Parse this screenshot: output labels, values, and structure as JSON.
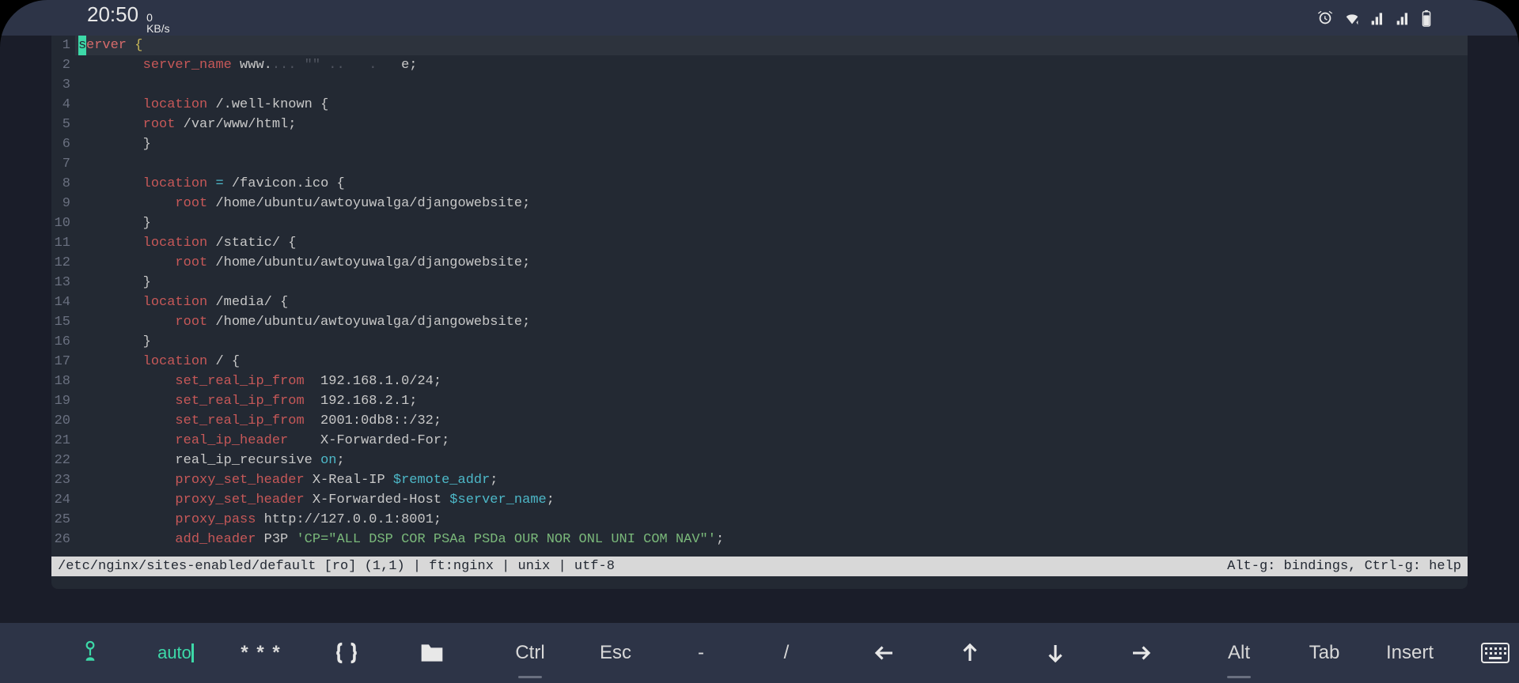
{
  "statusbar": {
    "time": "20:50",
    "net_value": "0",
    "net_unit": "KB/s"
  },
  "code": {
    "lines": [
      {
        "n": 1,
        "indent": 0,
        "tokens": [
          {
            "t": "s",
            "cls": "cursor-block"
          },
          {
            "t": "erver",
            "cls": "kw-server"
          },
          {
            "t": " ",
            "cls": "plain"
          },
          {
            "t": "{",
            "cls": "kw-yellow"
          }
        ],
        "hl": true
      },
      {
        "n": 2,
        "indent": 8,
        "tokens": [
          {
            "t": "server_name",
            "cls": "kw-red"
          },
          {
            "t": " www.",
            "cls": "plain"
          },
          {
            "t": "... \"\" ..   .  ",
            "cls": "faded"
          },
          {
            "t": " e;",
            "cls": "plain"
          }
        ]
      },
      {
        "n": 3,
        "indent": 0,
        "tokens": []
      },
      {
        "n": 4,
        "indent": 8,
        "tokens": [
          {
            "t": "location",
            "cls": "kw-red"
          },
          {
            "t": " /.well-known {",
            "cls": "plain"
          }
        ]
      },
      {
        "n": 5,
        "indent": 8,
        "tokens": [
          {
            "t": "root",
            "cls": "kw-red"
          },
          {
            "t": " /var/www/html;",
            "cls": "plain"
          }
        ]
      },
      {
        "n": 6,
        "indent": 8,
        "tokens": [
          {
            "t": "}",
            "cls": "plain"
          }
        ]
      },
      {
        "n": 7,
        "indent": 0,
        "tokens": []
      },
      {
        "n": 8,
        "indent": 8,
        "tokens": [
          {
            "t": "location",
            "cls": "kw-red"
          },
          {
            "t": " ",
            "cls": "plain"
          },
          {
            "t": "=",
            "cls": "kw-cyan"
          },
          {
            "t": " /favicon.ico {",
            "cls": "plain"
          }
        ]
      },
      {
        "n": 9,
        "indent": 12,
        "tokens": [
          {
            "t": "root",
            "cls": "kw-red"
          },
          {
            "t": " /home/ubuntu/awtoyuwalga/djangowebsite;",
            "cls": "plain"
          }
        ]
      },
      {
        "n": 10,
        "indent": 8,
        "tokens": [
          {
            "t": "}",
            "cls": "plain"
          }
        ]
      },
      {
        "n": 11,
        "indent": 8,
        "tokens": [
          {
            "t": "location",
            "cls": "kw-red"
          },
          {
            "t": " /static/ {",
            "cls": "plain"
          }
        ]
      },
      {
        "n": 12,
        "indent": 12,
        "tokens": [
          {
            "t": "root",
            "cls": "kw-red"
          },
          {
            "t": " /home/ubuntu/awtoyuwalga/djangowebsite;",
            "cls": "plain"
          }
        ]
      },
      {
        "n": 13,
        "indent": 8,
        "tokens": [
          {
            "t": "}",
            "cls": "plain"
          }
        ]
      },
      {
        "n": 14,
        "indent": 8,
        "tokens": [
          {
            "t": "location",
            "cls": "kw-red"
          },
          {
            "t": " /media/ {",
            "cls": "plain"
          }
        ]
      },
      {
        "n": 15,
        "indent": 12,
        "tokens": [
          {
            "t": "root",
            "cls": "kw-red"
          },
          {
            "t": " /home/ubuntu/awtoyuwalga/djangowebsite;",
            "cls": "plain"
          }
        ]
      },
      {
        "n": 16,
        "indent": 8,
        "tokens": [
          {
            "t": "}",
            "cls": "plain"
          }
        ]
      },
      {
        "n": 17,
        "indent": 8,
        "tokens": [
          {
            "t": "location",
            "cls": "kw-red"
          },
          {
            "t": " / {",
            "cls": "plain"
          }
        ]
      },
      {
        "n": 18,
        "indent": 12,
        "tokens": [
          {
            "t": "set_real_ip_from",
            "cls": "kw-red"
          },
          {
            "t": "  192.168.1.0/24;",
            "cls": "plain"
          }
        ]
      },
      {
        "n": 19,
        "indent": 12,
        "tokens": [
          {
            "t": "set_real_ip_from",
            "cls": "kw-red"
          },
          {
            "t": "  192.168.2.1;",
            "cls": "plain"
          }
        ]
      },
      {
        "n": 20,
        "indent": 12,
        "tokens": [
          {
            "t": "set_real_ip_from",
            "cls": "kw-red"
          },
          {
            "t": "  2001:0db8::/32;",
            "cls": "plain"
          }
        ]
      },
      {
        "n": 21,
        "indent": 12,
        "tokens": [
          {
            "t": "real_ip_header",
            "cls": "kw-red"
          },
          {
            "t": "    X-Forwarded-For;",
            "cls": "plain"
          }
        ]
      },
      {
        "n": 22,
        "indent": 12,
        "tokens": [
          {
            "t": "real_ip_recursive ",
            "cls": "plain"
          },
          {
            "t": "on",
            "cls": "kw-cyan"
          },
          {
            "t": ";",
            "cls": "plain"
          }
        ]
      },
      {
        "n": 23,
        "indent": 12,
        "tokens": [
          {
            "t": "proxy_set_header",
            "cls": "kw-red"
          },
          {
            "t": " X-Real-IP ",
            "cls": "plain"
          },
          {
            "t": "$remote_addr",
            "cls": "kw-cyan"
          },
          {
            "t": ";",
            "cls": "plain"
          }
        ]
      },
      {
        "n": 24,
        "indent": 12,
        "tokens": [
          {
            "t": "proxy_set_header",
            "cls": "kw-red"
          },
          {
            "t": " X-Forwarded-Host ",
            "cls": "plain"
          },
          {
            "t": "$server_name",
            "cls": "kw-cyan"
          },
          {
            "t": ";",
            "cls": "plain"
          }
        ]
      },
      {
        "n": 25,
        "indent": 12,
        "tokens": [
          {
            "t": "proxy_pass",
            "cls": "kw-red"
          },
          {
            "t": " http://127.0.0.1:8001;",
            "cls": "plain"
          }
        ]
      },
      {
        "n": 26,
        "indent": 12,
        "tokens": [
          {
            "t": "add_header",
            "cls": "kw-red"
          },
          {
            "t": " P3P ",
            "cls": "plain"
          },
          {
            "t": "'CP=\"ALL DSP COR PSAa PSDa OUR NOR ONL UNI COM NAV\"'",
            "cls": "kw-green"
          },
          {
            "t": ";",
            "cls": "plain"
          }
        ]
      }
    ]
  },
  "statusline": {
    "left": "/etc/nginx/sites-enabled/default [ro] (1,1) | ft:nginx | unix | utf-8",
    "right": "Alt-g: bindings, Ctrl-g: help"
  },
  "toolbar": {
    "auto": "auto",
    "stars": "* * *",
    "ctrl": "Ctrl",
    "esc": "Esc",
    "dash": "-",
    "slash": "/",
    "alt": "Alt",
    "tab": "Tab",
    "insert": "Insert"
  }
}
